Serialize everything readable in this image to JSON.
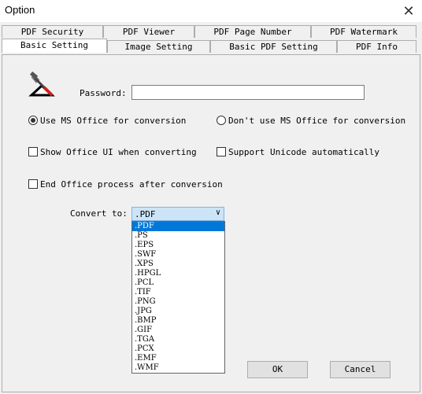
{
  "window": {
    "title": "Option",
    "close_glyph": "✕"
  },
  "tabs_row1": [
    "PDF Security",
    "PDF Viewer",
    "PDF Page Number",
    "PDF Watermark"
  ],
  "tabs_row2": [
    "Basic Setting",
    "Image Setting",
    "Basic PDF Setting",
    "PDF Info"
  ],
  "form": {
    "password_label": "Password:",
    "password_value": "",
    "radio_use_office": "Use MS Office for conversion",
    "radio_no_office": "Don't use MS Office for conversion",
    "check_show_ui": "Show Office UI when converting",
    "check_unicode": "Support Unicode automatically",
    "check_end_process": "End Office process after conversion",
    "convert_label": "Convert to:",
    "convert_value": ".PDF",
    "options": [
      ".PDF",
      ".PS",
      ".EPS",
      ".SWF",
      ".XPS",
      ".HPGL",
      ".PCL",
      ".TIF",
      ".PNG",
      ".JPG",
      ".BMP",
      ".GIF",
      ".TGA",
      ".PCX",
      ".EMF",
      ".WMF"
    ]
  },
  "buttons": {
    "ok": "OK",
    "cancel": "Cancel"
  },
  "state": {
    "use_office_selected": true,
    "show_ui": false,
    "unicode": false,
    "end_process": false
  },
  "colors": {
    "accent": "#0078d7",
    "tab_border": "#adadad"
  }
}
